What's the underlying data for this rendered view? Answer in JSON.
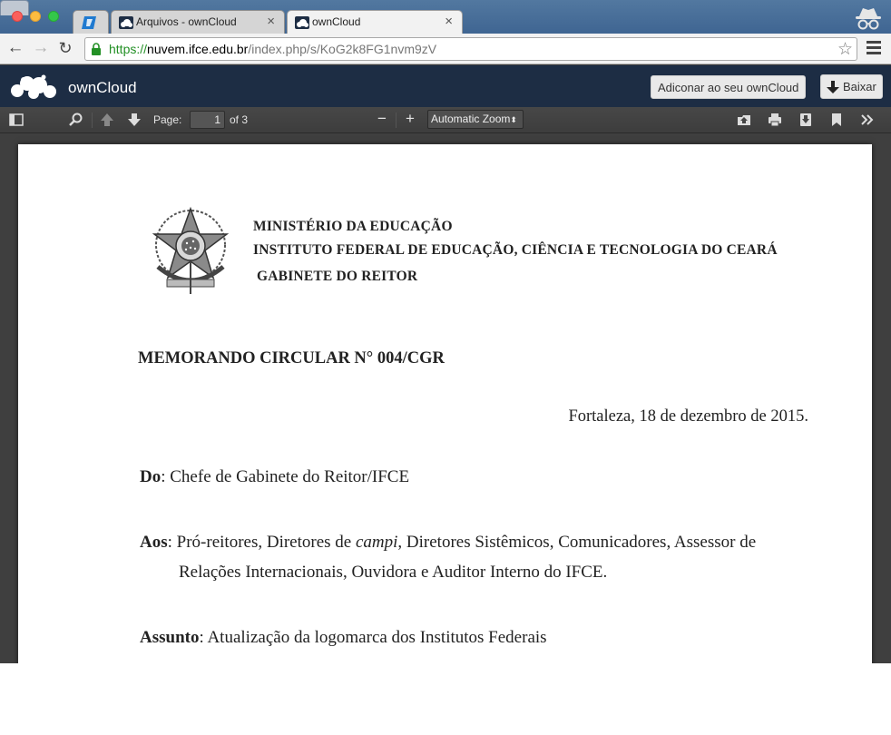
{
  "browser": {
    "tabs": [
      {
        "title": "",
        "favicon": "blue-app-favicon"
      },
      {
        "title": "Arquivos - ownCloud",
        "favicon": "owncloud-favicon",
        "close": "×"
      },
      {
        "title": "ownCloud",
        "favicon": "owncloud-favicon",
        "close": "×",
        "active": true
      }
    ],
    "url": {
      "scheme": "https://",
      "host": "nuvem.ifce.edu.br",
      "path": "/index.php/s/KoG2k8FG1nvm9zV"
    },
    "secure": true,
    "incognito": true
  },
  "owncloud": {
    "app_name": "ownCloud",
    "add_button": "Adiconar ao seu ownCloud",
    "download_button": "Baixar",
    "header_color": "#1d2d44"
  },
  "pdf_toolbar": {
    "page_label": "Page:",
    "current_page": "1",
    "of_pages": "of 3",
    "zoom": "Automatic Zoom",
    "zoom_minus": "−",
    "zoom_plus": "+"
  },
  "document": {
    "header_lines": [
      "MINISTÉRIO DA EDUCAÇÃO",
      "INSTITUTO FEDERAL DE EDUCAÇÃO, CIÊNCIA E TECNOLOGIA DO CEARÁ",
      "GABINETE DO REITOR"
    ],
    "memo_title": "MEMORANDO CIRCULAR N° 004/CGR",
    "place_date": "Fortaleza, 18 de dezembro de 2015.",
    "from_label": "Do",
    "from_value": ": Chefe de Gabinete do Reitor/IFCE",
    "to_label": "Aos",
    "to_value_a": ": Pró-reitores, Diretores de ",
    "to_value_italic": "campi",
    "to_value_b": ", Diretores Sistêmicos, Comunicadores, Assessor de",
    "to_value_line2": "Relações Internacionais, Ouvidora e Auditor Interno do IFCE.",
    "subject_label": "Assunto",
    "subject_value": ": Atualização da logomarca dos Institutos Federais"
  }
}
